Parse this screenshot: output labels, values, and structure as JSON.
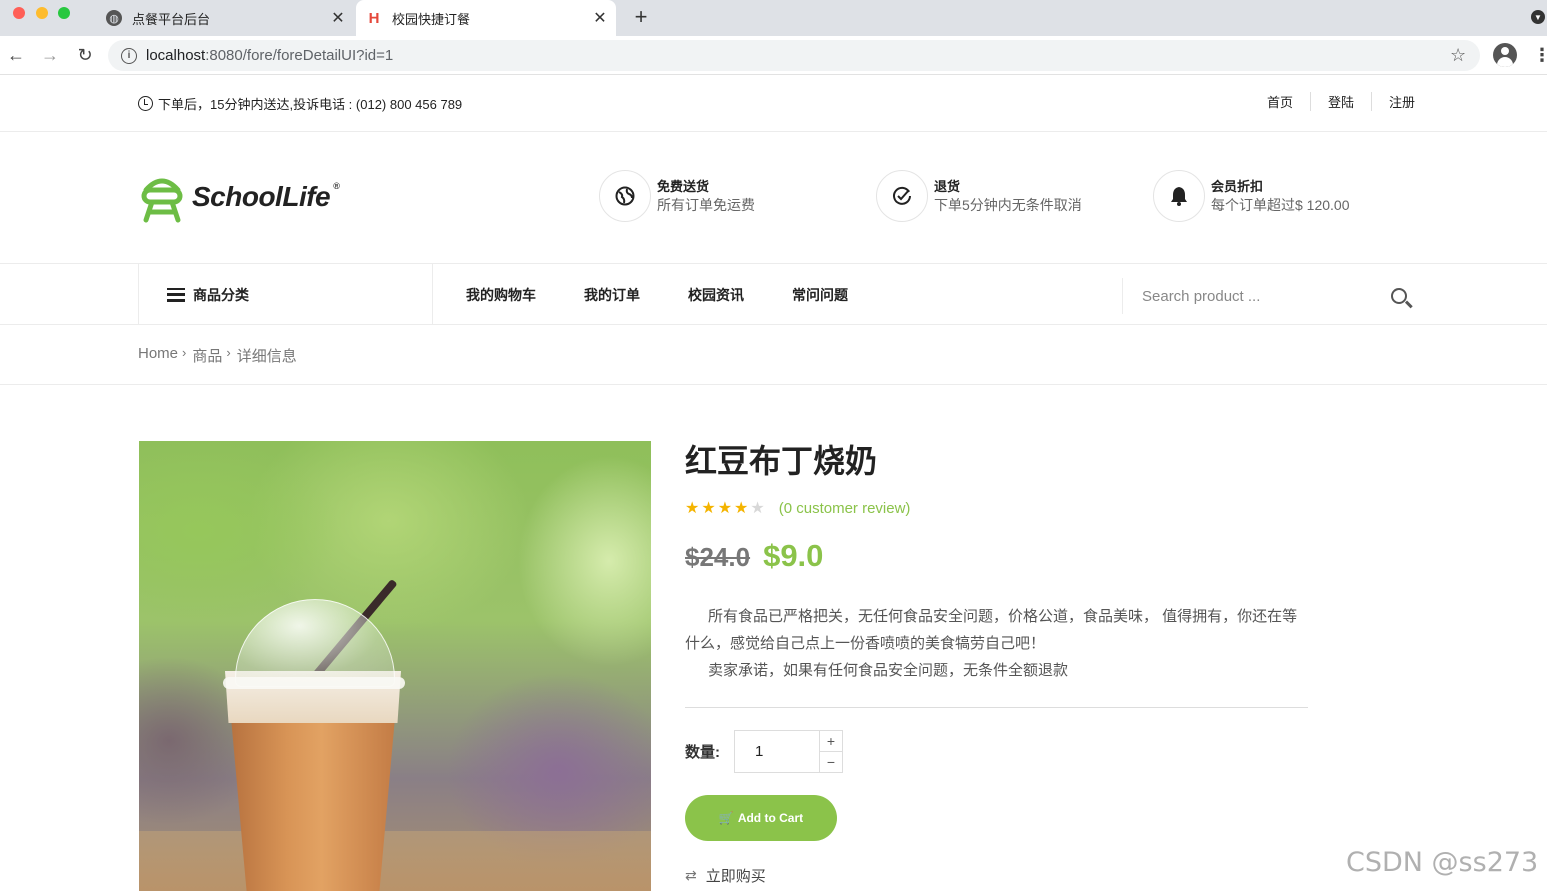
{
  "browser": {
    "tabs": [
      {
        "title": "点餐平台后台",
        "active": false
      },
      {
        "title": "校园快捷订餐",
        "active": true
      }
    ],
    "url": {
      "host": "localhost",
      "path": ":8080/fore/foreDetailUI?id=1"
    }
  },
  "topbar": {
    "notice": "下单后，15分钟内送达,投诉电话 : (012) 800 456 789",
    "links": [
      "首页",
      "登陆",
      "注册"
    ]
  },
  "logo": {
    "school": "School",
    "life": "Life",
    "reg": "®"
  },
  "services": [
    {
      "title": "免费送货",
      "desc": "所有订单免运费",
      "icon": "globe-icon"
    },
    {
      "title": "退货",
      "desc": "下单5分钟内无条件取消",
      "icon": "check-circle-icon"
    },
    {
      "title": "会员折扣",
      "desc": "每个订单超过$ 120.00",
      "icon": "bell-icon"
    }
  ],
  "nav": {
    "category": "商品分类",
    "items": [
      "我的购物车",
      "我的订单",
      "校园资讯",
      "常问问题"
    ],
    "search_placeholder": "Search product ..."
  },
  "breadcrumb": [
    "Home",
    "商品",
    "详细信息"
  ],
  "product": {
    "title": "红豆布丁烧奶",
    "rating": 4,
    "rating_max": 5,
    "review_text": "(0 customer review)",
    "old_price": "$24.0",
    "new_price": "$9.0",
    "desc_1": "所有食品已严格把关，无任何食品安全问题，价格公道，食品美味， 值得拥有，你还在等什么，感觉给自己点上一份香喷喷的美食犒劳自己吧！",
    "desc_2": "卖家承诺，如果有任何食品安全问题，无条件全额退款",
    "qty_label": "数量:",
    "qty_value": "1",
    "add_to_cart": "Add to Cart",
    "buy_now": "立即购买"
  },
  "colors": {
    "accent": "#8bc34a",
    "star": "#f4b400"
  },
  "watermark": "CSDN @ss273"
}
